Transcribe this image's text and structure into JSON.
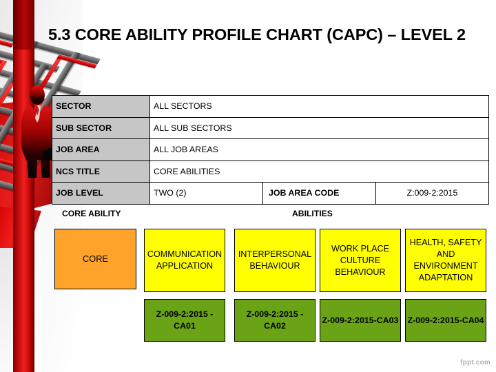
{
  "slide": {
    "title": "5.3  CORE ABILITY PROFILE CHART (CAPC)  – LEVEL 2",
    "watermark": "fppt.com"
  },
  "info_table": {
    "rows": [
      {
        "label": "SECTOR",
        "value": "ALL SECTORS"
      },
      {
        "label": "SUB SECTOR",
        "value": "ALL SUB SECTORS"
      },
      {
        "label": "JOB AREA",
        "value": "ALL JOB AREAS"
      },
      {
        "label": "NCS TITLE",
        "value": "CORE ABILITIES"
      }
    ],
    "job_level": {
      "label": "JOB LEVEL",
      "value": "TWO (2)",
      "code_label": "JOB AREA CODE",
      "code_value": "Z:009-2:2015"
    }
  },
  "captions": {
    "core_ability": "CORE ABILITY",
    "abilities": "ABILITIES"
  },
  "core_box": {
    "label": "CORE"
  },
  "abilities": [
    {
      "name": "COMMUNICATION APPLICATION",
      "code": "Z-009-2:2015 -CA01"
    },
    {
      "name": "INTERPERSONAL BEHAVIOUR",
      "code": "Z-009-2:2015 -CA02"
    },
    {
      "name": "WORK PLACE CULTURE BEHAVIOUR",
      "code": "Z-009-2:2015-CA03"
    },
    {
      "name": "HEALTH, SAFETY AND ENVIRONMENT ADAPTATION",
      "code": "Z-009-2:2015-CA04"
    }
  ],
  "colors": {
    "core_box": "#ffa32b",
    "ability_name_box": "#ffff00",
    "ability_code_box": "#6aa316",
    "table_label_cell": "#c6c6c6",
    "accent_red": "#d21010"
  }
}
